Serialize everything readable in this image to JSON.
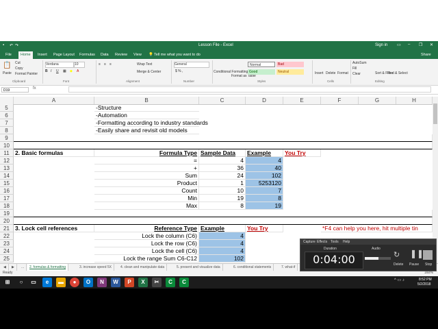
{
  "window": {
    "title": "Lesson File - Excel",
    "sign_in": "Sign in",
    "share": "Share"
  },
  "ribbon_tabs": [
    "File",
    "Home",
    "Insert",
    "Page Layout",
    "Formulas",
    "Data",
    "Review",
    "View"
  ],
  "tell_me": "Tell me what you want to do",
  "ribbon": {
    "paste": "Paste",
    "cut": "Cut",
    "copy": "Copy",
    "format_painter": "Format Painter",
    "font_name": "Verdana",
    "font_size": "10",
    "wrap_text": "Wrap Text",
    "merge_center": "Merge & Center",
    "number_format": "General",
    "conditional": "Conditional Formatting",
    "format_table": "Format as Table",
    "styles": {
      "normal": "Normal",
      "bad": "Bad",
      "good": "Good",
      "neutral": "Neutral"
    },
    "insert": "Insert",
    "delete": "Delete",
    "format": "Format",
    "autosum": "AutoSum",
    "fill": "Fill",
    "clear": "Clear",
    "sort_filter": "Sort & Filter",
    "find_select": "Find & Select",
    "groups": {
      "clipboard": "Clipboard",
      "font": "Font",
      "alignment": "Alignment",
      "number": "Number",
      "styles": "Styles",
      "cells": "Cells",
      "editing": "Editing"
    }
  },
  "name_box": "D19",
  "columns": [
    "A",
    "B",
    "C",
    "D",
    "E",
    "F",
    "G",
    "H"
  ],
  "rows": {
    "r5": {
      "num": "5",
      "b": "-Structure"
    },
    "r6": {
      "num": "6",
      "b": "-Automation"
    },
    "r7": {
      "num": "7",
      "b": "-Formatting according to industry standards"
    },
    "r8": {
      "num": "8",
      "b": "-Easily share and revisit old models"
    },
    "r9": {
      "num": "9"
    },
    "r10": {
      "num": "10"
    },
    "r11": {
      "num": "11",
      "a": "2. Basic formulas",
      "b": "Formula Type",
      "c": "Sample Data",
      "d": "Example",
      "e": "You Try"
    },
    "r12": {
      "num": "12",
      "b": "=",
      "c": "4",
      "d": "4"
    },
    "r13": {
      "num": "13",
      "b": "+",
      "c": "36",
      "d": "40"
    },
    "r14": {
      "num": "14",
      "b": "Sum",
      "c": "24",
      "d": "102"
    },
    "r15": {
      "num": "15",
      "b": "Product",
      "c": "1",
      "d": "5253120"
    },
    "r16": {
      "num": "16",
      "b": "Count",
      "c": "10",
      "d": "7"
    },
    "r17": {
      "num": "17",
      "b": "Min",
      "c": "19",
      "d": "8"
    },
    "r18": {
      "num": "18",
      "b": "Max",
      "c": "8",
      "d": "19"
    },
    "r19": {
      "num": "19"
    },
    "r20": {
      "num": "20"
    },
    "r21": {
      "num": "21",
      "a": "3. Lock cell references",
      "b": "Reference Type",
      "c": "Example",
      "d": "You Try",
      "e": "*F4 can help you here, hit multiple tin"
    },
    "r22": {
      "num": "22",
      "b": "Lock the column (C6)",
      "c": "4"
    },
    "r23": {
      "num": "23",
      "b": "Lock the row (C6)",
      "c": "4"
    },
    "r24": {
      "num": "24",
      "b": "Lock the cell (C6)",
      "c": "4"
    },
    "r25": {
      "num": "25",
      "b": "Lock the range Sum C6-C12",
      "c": "102"
    }
  },
  "sheet_tabs": [
    "2. formulas & formatting",
    "3. increase speed 5X",
    "4. clean and manipulate data",
    "5. present and visualize data",
    "6. conditional statements",
    "7. what-if"
  ],
  "status": {
    "ready": "Ready",
    "zoom": "160%"
  },
  "clock": {
    "time": "8:52 PM",
    "date": "5/2/2018"
  },
  "recorder": {
    "menu": [
      "Capture",
      "Effects",
      "Tools",
      "Help"
    ],
    "duration_label": "Duration",
    "audio_label": "Audio",
    "time": "0:04:00",
    "delete": "Delete",
    "pause": "Pause",
    "stop": "Stop"
  },
  "colors": {
    "excel_green": "#217346",
    "highlight_blue": "#9dc3e6",
    "red_text": "#c00000"
  }
}
